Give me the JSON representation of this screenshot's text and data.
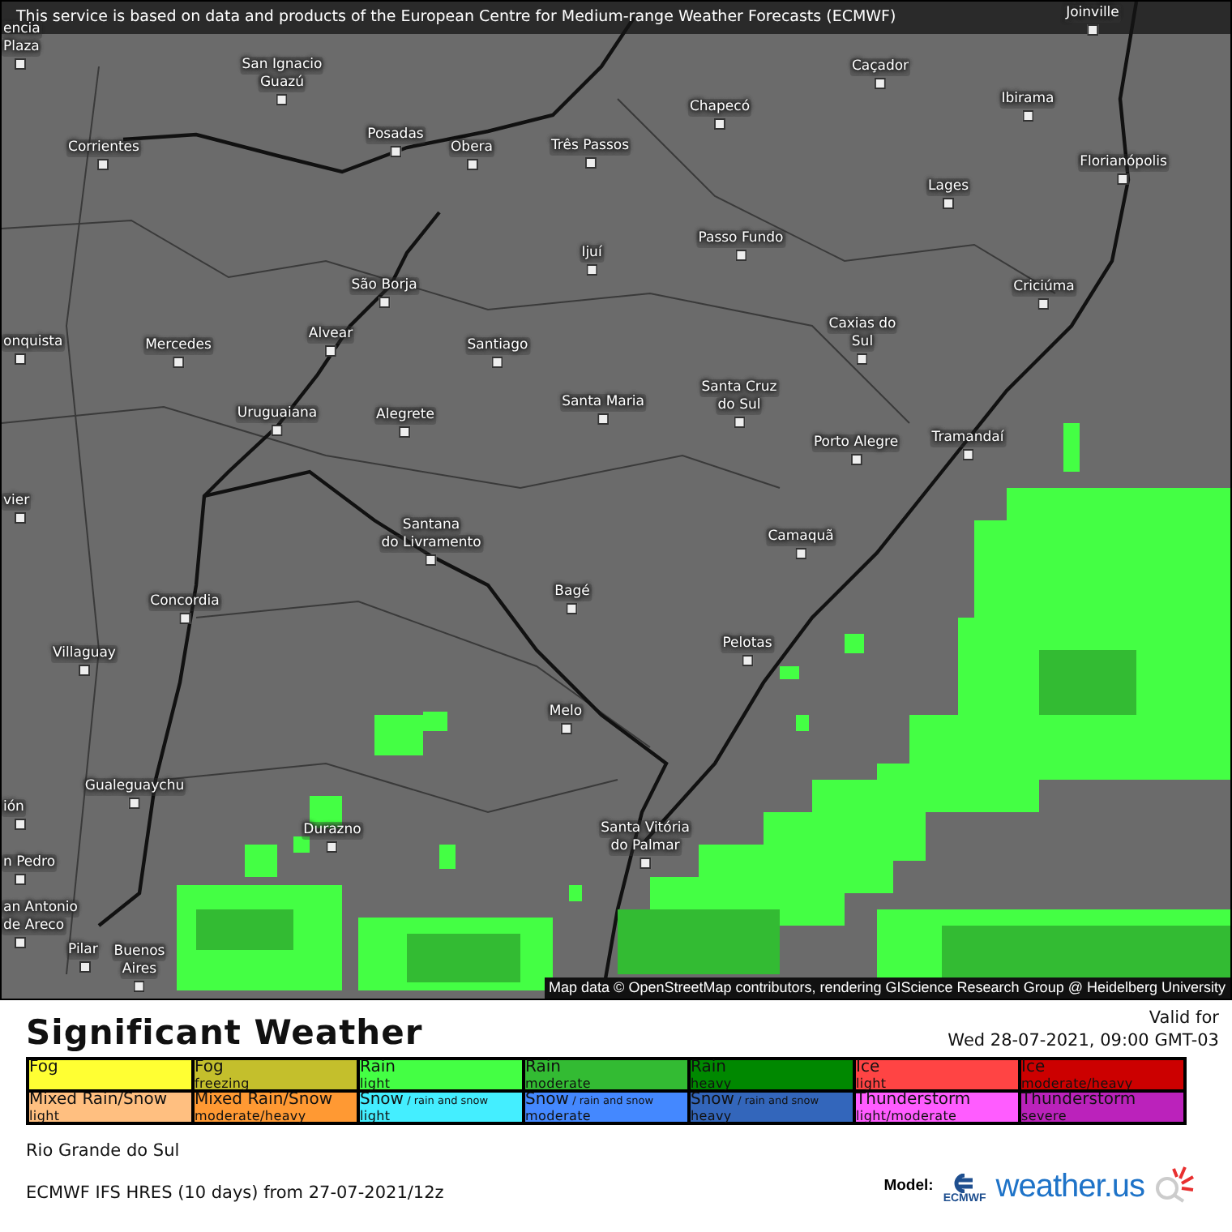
{
  "map": {
    "notice": "This service is based on data and products of the European Centre for Medium-range Weather Forecasts (ECMWF)",
    "places": [
      {
        "lines": [
          "Joinville"
        ]
      },
      {
        "lines": [
          "encia",
          "Plaza"
        ]
      },
      {
        "lines": [
          "San Ignacio",
          "Guazú"
        ]
      },
      {
        "lines": [
          "Caçador"
        ]
      },
      {
        "lines": [
          "Chapecó"
        ]
      },
      {
        "lines": [
          "Ibirama"
        ]
      },
      {
        "lines": [
          "Corrientes"
        ]
      },
      {
        "lines": [
          "Posadas"
        ]
      },
      {
        "lines": [
          "Obera"
        ]
      },
      {
        "lines": [
          "Três Passos"
        ]
      },
      {
        "lines": [
          "Florianópolis"
        ]
      },
      {
        "lines": [
          "Lages"
        ]
      },
      {
        "lines": [
          "Passo Fundo"
        ]
      },
      {
        "lines": [
          "Ijuí"
        ]
      },
      {
        "lines": [
          "São Borja"
        ]
      },
      {
        "lines": [
          "Criciúma"
        ]
      },
      {
        "lines": [
          "onquista"
        ]
      },
      {
        "lines": [
          "Alvear"
        ]
      },
      {
        "lines": [
          "Mercedes"
        ]
      },
      {
        "lines": [
          "Santiago"
        ]
      },
      {
        "lines": [
          "Caxias do",
          "Sul"
        ]
      },
      {
        "lines": [
          "Uruguaiana"
        ]
      },
      {
        "lines": [
          "Alegrete"
        ]
      },
      {
        "lines": [
          "Santa Maria"
        ]
      },
      {
        "lines": [
          "Santa Cruz",
          "do Sul"
        ]
      },
      {
        "lines": [
          "Porto Alegre"
        ]
      },
      {
        "lines": [
          "Tramandaí"
        ]
      },
      {
        "lines": [
          "vier"
        ]
      },
      {
        "lines": [
          "Santana",
          "do Livramento"
        ]
      },
      {
        "lines": [
          "Camaquã"
        ]
      },
      {
        "lines": [
          "Concordia"
        ]
      },
      {
        "lines": [
          "Bagé"
        ]
      },
      {
        "lines": [
          "Villaguay"
        ]
      },
      {
        "lines": [
          "Pelotas"
        ]
      },
      {
        "lines": [
          "Melo"
        ]
      },
      {
        "lines": [
          "Gualeguaychu"
        ]
      },
      {
        "lines": [
          "ión"
        ]
      },
      {
        "lines": [
          "Durazno"
        ]
      },
      {
        "lines": [
          "Santa Vitória",
          "do Palmar"
        ]
      },
      {
        "lines": [
          "n Pedro"
        ]
      },
      {
        "lines": [
          "an Antonio",
          "de Areco"
        ]
      },
      {
        "lines": [
          "Pilar"
        ]
      },
      {
        "lines": [
          "Buenos",
          "Aires"
        ]
      }
    ],
    "attribution": "Map data © OpenStreetMap contributors, rendering GIScience Research Group @ Heidelberg University"
  },
  "title": "Significant Weather",
  "valid": {
    "label": "Valid for",
    "time": "Wed 28-07-2021, 09:00 GMT-03"
  },
  "legend": [
    {
      "label": "Fog",
      "color": "#ffff33"
    },
    {
      "label": "Fog",
      "sub": "freezing",
      "color": "#c4bf2c"
    },
    {
      "label": "Rain",
      "sub": "light",
      "color": "#44ff44"
    },
    {
      "label": "Rain",
      "sub": "moderate",
      "color": "#33bb33"
    },
    {
      "label": "Rain",
      "sub": "heavy",
      "color": "#008800"
    },
    {
      "label": "Ice",
      "sub": "light",
      "color": "#ff4444"
    },
    {
      "label": "Ice",
      "sub": "moderate/heavy",
      "color": "#cc0000"
    },
    {
      "label": "Mixed Rain/Snow",
      "sub": "light",
      "color": "#ffbf80"
    },
    {
      "label": "Mixed Rain/Snow",
      "sub": "moderate/heavy",
      "color": "#ff9933"
    },
    {
      "label": "Snow",
      "note": "/ rain and snow",
      "sub": "light",
      "color": "#44eeff"
    },
    {
      "label": "Snow",
      "note": "/ rain and snow",
      "sub": "moderate",
      "color": "#4488ff"
    },
    {
      "label": "Snow",
      "note": "/ rain and snow",
      "sub": "heavy",
      "color": "#3366bb"
    },
    {
      "label": "Thunderstorm",
      "sub": "light/moderate",
      "color": "#ff5cff"
    },
    {
      "label": "Thunderstorm",
      "sub": "severe",
      "color": "#bb22bb"
    }
  ],
  "region": "Rio Grande do Sul",
  "model_run": "ECMWF IFS HRES (10 days) from  27-07-2021/12z",
  "model_label": "Model:",
  "ecmwf": "ECMWF",
  "brand": "weather.us"
}
